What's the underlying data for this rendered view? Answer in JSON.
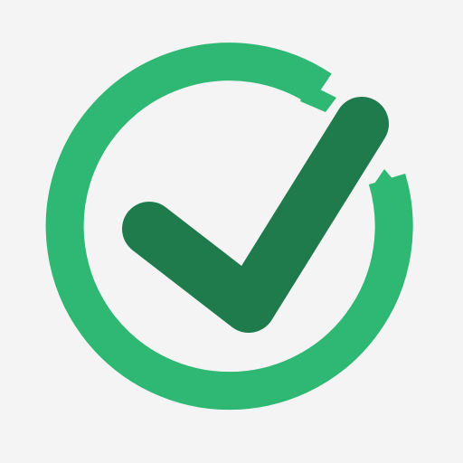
{
  "icon": {
    "name": "checkmark-circle-icon",
    "colors": {
      "background": "#f4f4f4",
      "ring": "#2fb774",
      "check": "#1f7a4c"
    }
  }
}
